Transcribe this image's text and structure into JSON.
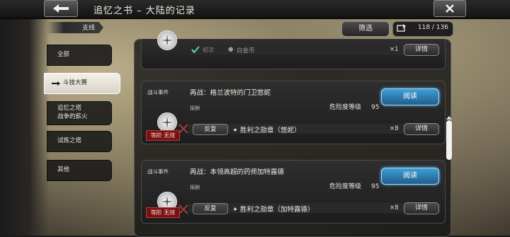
{
  "header": {
    "title": "追忆之书 – 大陆的记录"
  },
  "branch": {
    "label": "支线"
  },
  "toolbar": {
    "filter_label": "筛选",
    "counter": "118 / 136"
  },
  "sidebar": {
    "items": [
      {
        "label": "全部"
      },
      {
        "label": "斗技大赛"
      },
      {
        "label1": "追忆之塔",
        "label2": "战争的薪火"
      },
      {
        "label": "试炼之塔"
      },
      {
        "label": "其他"
      }
    ]
  },
  "entries": [
    {
      "status_label": "初次",
      "reward_name": "白金币",
      "quantity": "×1",
      "detail_label": "详情"
    },
    {
      "event_tag": "战斗事件",
      "title": "再战：格兰波特的门卫悠妮",
      "read_label": "阅读",
      "reward_label": "报酬",
      "danger_label": "危险度等级",
      "danger_value": "95",
      "invalid_label": "等阶 无效",
      "repeat_label": "反复",
      "reward_name": "胜利之勋章（悠妮）",
      "quantity": "×8",
      "detail_label": "详情"
    },
    {
      "event_tag": "战斗事件",
      "title": "再战：本领高超的药师加特露德",
      "read_label": "阅读",
      "reward_label": "报酬",
      "danger_label": "危险度等级",
      "danger_value": "95",
      "invalid_label": "等阶 无效",
      "repeat_label": "反复",
      "reward_name": "胜利之勋章（加特露德）",
      "quantity": "×8",
      "detail_label": "详情"
    }
  ],
  "colors": {
    "accent": "#2f8bc4",
    "invalid": "#7a1111"
  }
}
